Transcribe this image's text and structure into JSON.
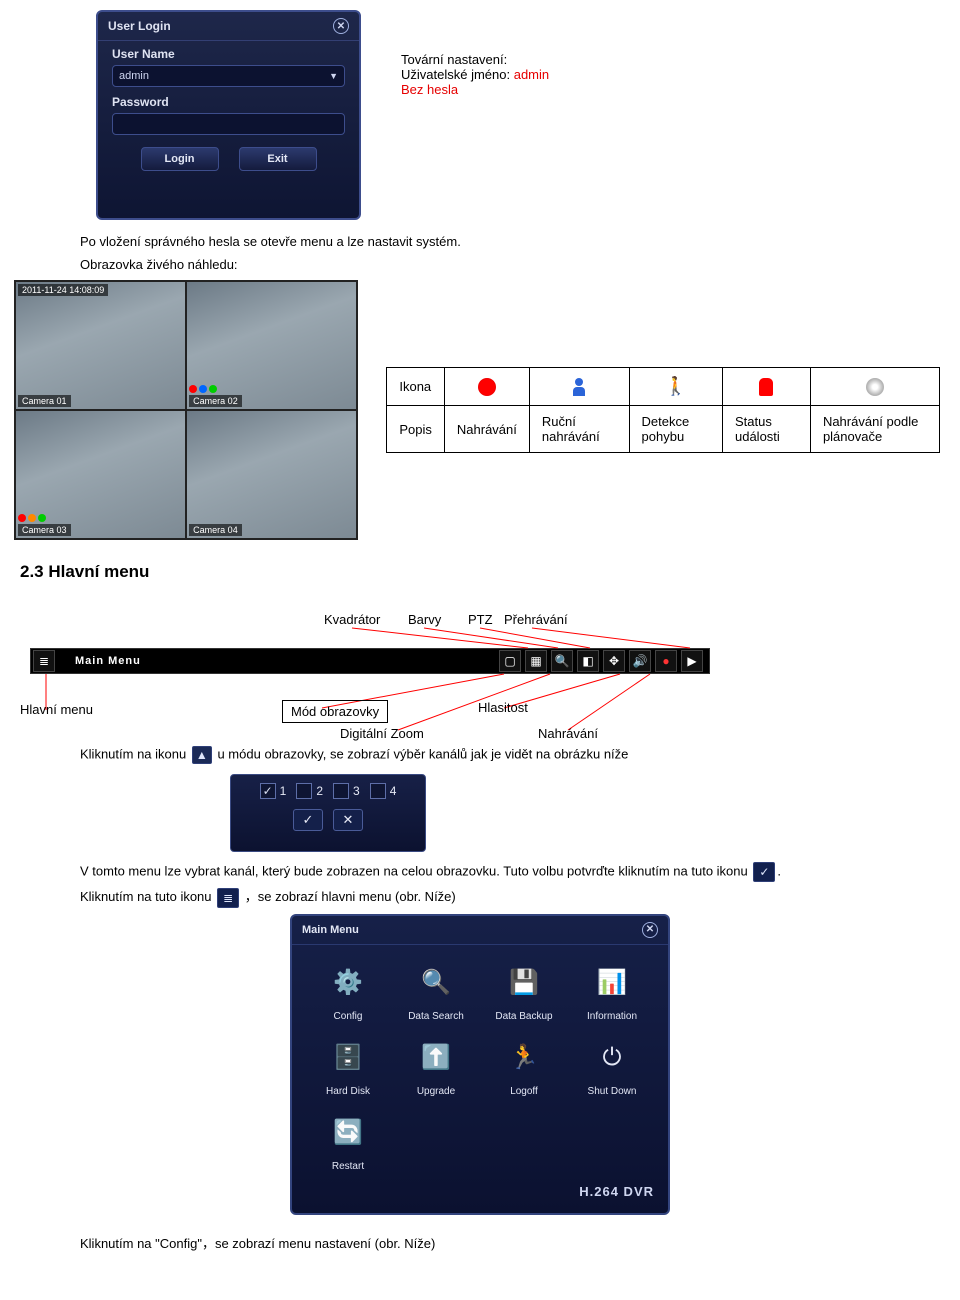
{
  "login": {
    "title": "User Login",
    "userLabel": "User Name",
    "userValue": "admin",
    "passLabel": "Password",
    "loginBtn": "Login",
    "exitBtn": "Exit"
  },
  "factory": {
    "line1": "Tovární nastavení:",
    "line2a": "Uživatelské jméno: ",
    "line2b": "admin",
    "line3": "Bez hesla"
  },
  "text": {
    "afterLogin": "Po vložení správného hesla se otevře menu a lze nastavit systém.",
    "livePreview": "Obrazovka živého náhledu:",
    "secHead": "2.3 Hlavní menu",
    "clickIconPart1": "Kliknutím na ikonu ",
    "clickIconPart2": " u módu obrazovky, se zobrazí výběr kanálů jak je vidět na obrázku níže",
    "chanLine1a": "V tomto menu lze vybrat kanál, který bude zobrazen na celou obrazovku. Tuto volbu potvrďte kliknutím na tuto ikonu ",
    "chanLine1b": ".",
    "chanLine2a": "Kliknutím na tuto ikonu ",
    "chanLine2b": "，se zobrazí hlavni menu (obr. Níže)",
    "configLine": "Kliknutím na \"Config\"，se zobrazí menu nastavení (obr. Níže)"
  },
  "cams": {
    "ts": "2011-11-24 14:08:09",
    "c1": "Camera 01",
    "c2": "Camera 02",
    "c3": "Camera 03",
    "c4": "Camera 04"
  },
  "legend": {
    "hIcon": "Ikona",
    "hPopis": "Popis",
    "c1": "Nahrávání",
    "c2": "Ruční nahrávání",
    "c3": "Detekce pohybu",
    "c4": "Status události",
    "c5": "Nahrávání podle plánovače"
  },
  "diagram": {
    "kvadrator": "Kvadrátor",
    "barvy": "Barvy",
    "ptz": "PTZ",
    "prehravani": "Přehrávání",
    "hlavniMenu": "Hlavní menu",
    "modObrazovky": "Mód obrazovky",
    "digitalniZoom": "Digitální Zoom",
    "hlasitost": "Hlasitost",
    "nahravani": "Nahrávání",
    "barTitle": "Main Menu"
  },
  "chansel": {
    "c1": "1",
    "c2": "2",
    "c3": "3",
    "c4": "4"
  },
  "mainmenu": {
    "title": "Main Menu",
    "items": [
      "Config",
      "Data Search",
      "Data Backup",
      "Information",
      "Hard Disk",
      "Upgrade",
      "Logoff",
      "Shut Down",
      "Restart"
    ],
    "footer": "H.264 DVR"
  }
}
